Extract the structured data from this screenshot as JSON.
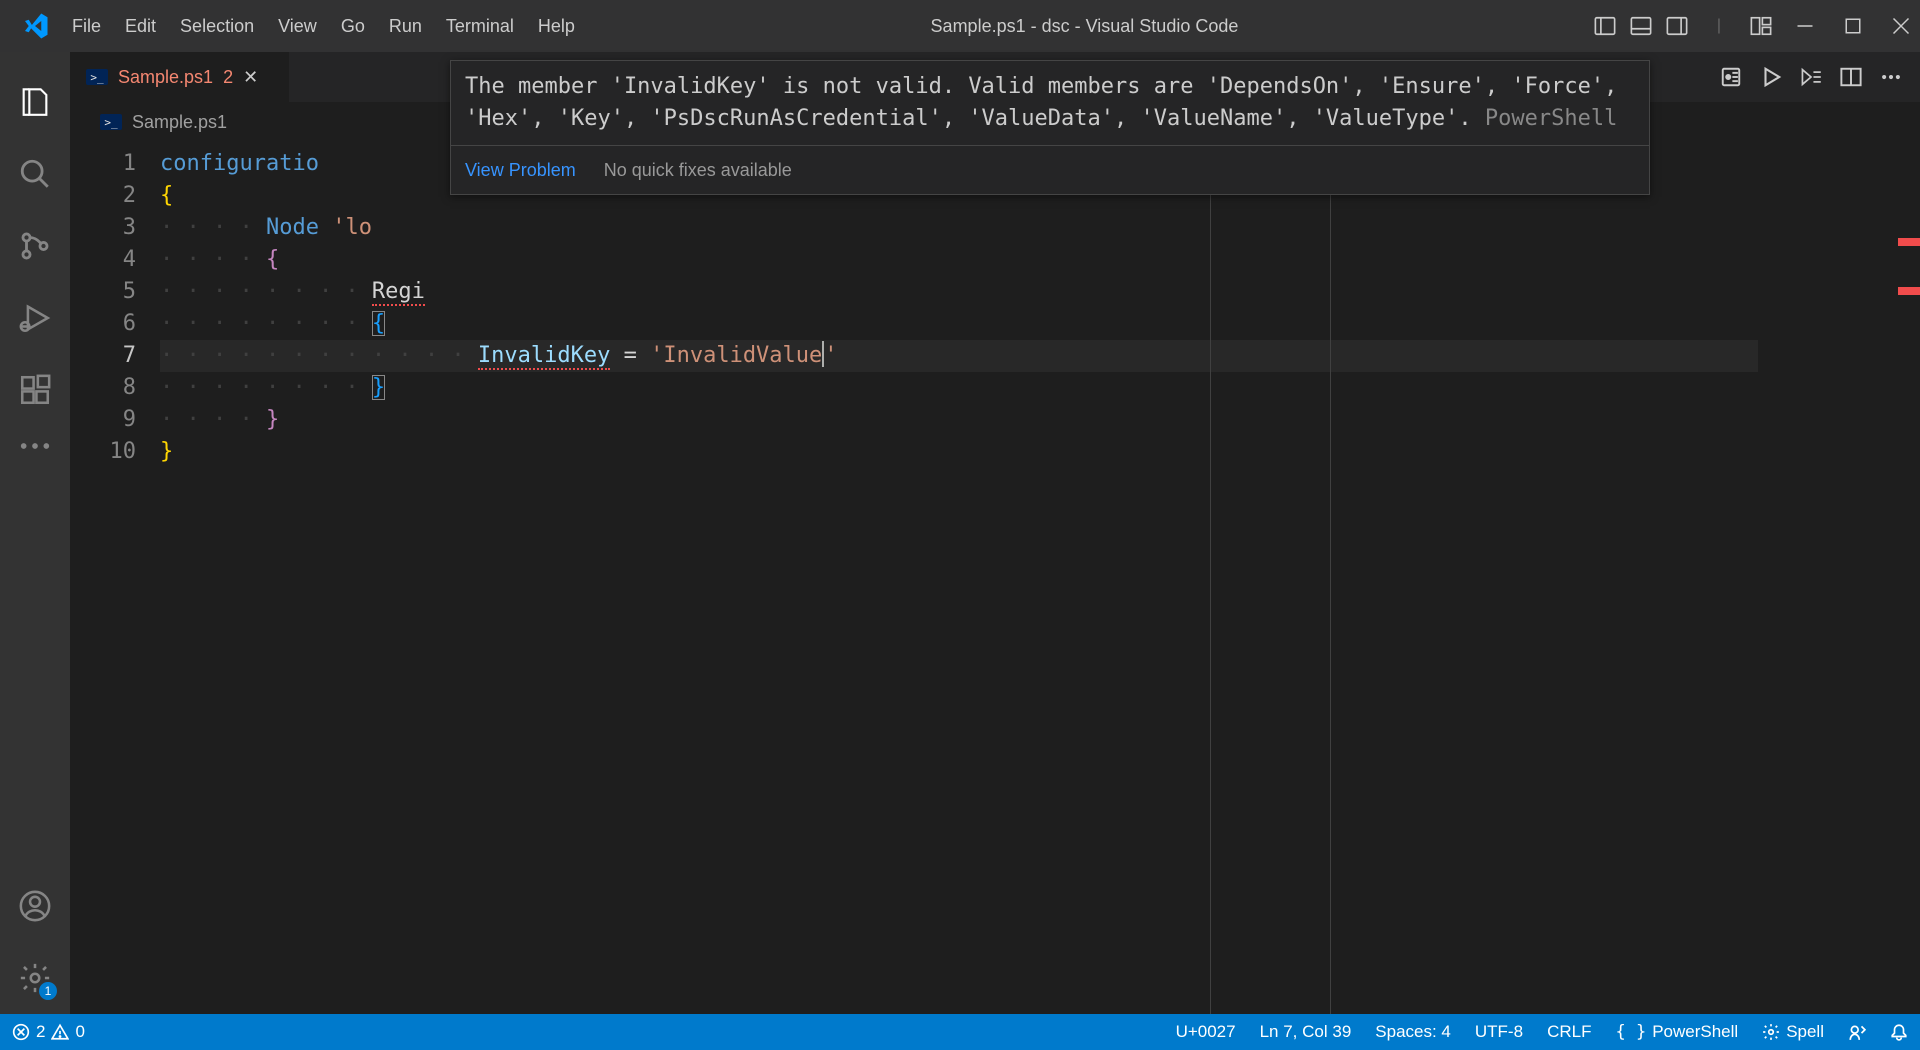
{
  "window": {
    "title": "Sample.ps1 - dsc - Visual Studio Code"
  },
  "menu": {
    "items": [
      "File",
      "Edit",
      "Selection",
      "View",
      "Go",
      "Run",
      "Terminal",
      "Help"
    ]
  },
  "activity": {
    "settings_badge": "1"
  },
  "tab": {
    "name": "Sample.ps1",
    "problem_count": "2"
  },
  "breadcrumb": {
    "file": "Sample.ps1"
  },
  "editor": {
    "line_numbers": [
      "1",
      "2",
      "3",
      "4",
      "5",
      "6",
      "7",
      "8",
      "9",
      "10"
    ],
    "lines": {
      "l1_kw": "configuratio",
      "l2_brace": "{",
      "l3_node": "Node",
      "l3_str_prefix": "'lo",
      "l5_regi": "Regi",
      "l6_brace": "{",
      "l7_key": "InvalidKey",
      "l7_eq": " = ",
      "l7_q1": "'",
      "l7_val": "InvalidValue",
      "l7_q2": "'",
      "l8_brace": "}",
      "l9_brace": "}",
      "l10_brace": "}"
    },
    "indent2": "· · · · ",
    "indent4": "· · · · · · · · ",
    "indent6": "· · · · · · · · · · · · "
  },
  "hover": {
    "message": "The member 'InvalidKey' is not valid. Valid members are 'DependsOn', 'Ensure', 'Force', 'Hex', 'Key', 'PsDscRunAsCredential', 'ValueData', 'ValueName', 'ValueType'.",
    "source": " PowerShell",
    "view_problem": "View Problem",
    "no_fix": "No quick fixes available"
  },
  "status": {
    "errors": "2",
    "warnings": "0",
    "codepoint": "U+0027",
    "cursor": "Ln 7, Col 39",
    "spaces": "Spaces: 4",
    "encoding": "UTF-8",
    "eol": "CRLF",
    "lang": "PowerShell",
    "spell": "Spell"
  }
}
